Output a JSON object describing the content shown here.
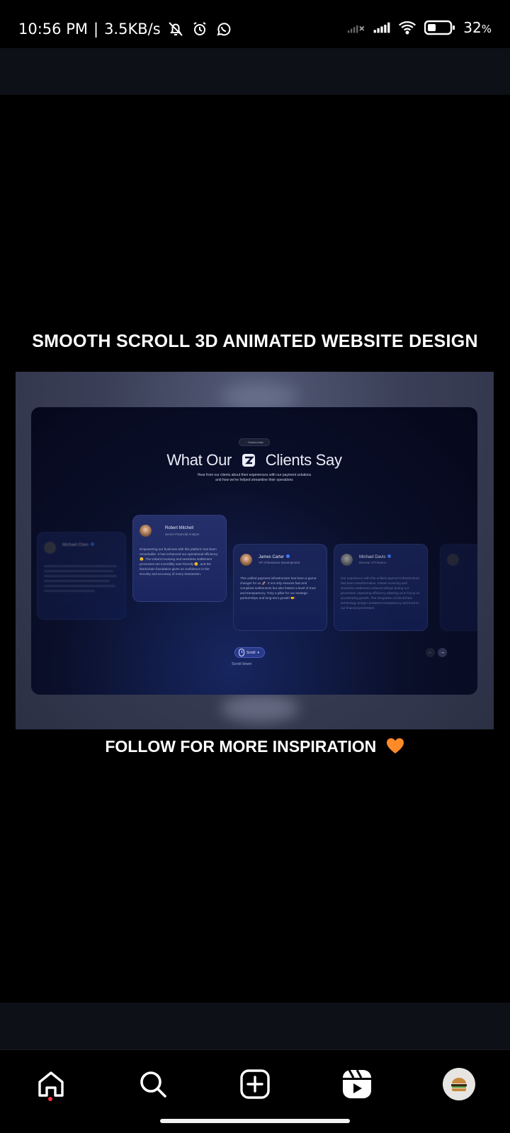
{
  "status_bar": {
    "time": "10:56 PM",
    "separator": "|",
    "speed": "3.5KB/s",
    "battery": "32",
    "battery_unit": "%",
    "icons": [
      "bell-off-icon",
      "alarm-icon",
      "whatsapp-icon",
      "signal-no-service-icon",
      "signal-icon",
      "wifi-icon",
      "battery-icon"
    ]
  },
  "post": {
    "caption_top": "SMOOTH SCROLL 3D ANIMATED WEBSITE DESIGN",
    "caption_bottom": "FOLLOW FOR MORE INSPIRATION"
  },
  "website": {
    "badge": "Testimonials",
    "title_left": "What Our",
    "title_right": "Clients Say",
    "subtitle": "Hear from our clients about their experiences with our payment solutions and how we've helped streamline their operations",
    "cards": [
      {
        "name": "Michael Chen",
        "role": "",
        "body": ""
      },
      {
        "name": "Robert Mitchell",
        "role": "Senior Financial Analyst",
        "body": "Empowering our business with this platform has been remarkable. It has enhanced our operational efficiency 🙂. The instant invoicing and seamless settlement processes are incredibly user-friendly 😊, and the blockchain foundation gives us confidence in the security and accuracy of every transaction."
      },
      {
        "name": "James Carter",
        "role": "VP of Business Development",
        "body": "This unified payment infrastructure has been a game-changer for us 🚀. It not only ensures fast and compliant settlements but also fosters a level of trust and transparency. Truly a pillar for our strategic partnerships and long-term growth 🤝."
      },
      {
        "name": "Michael Davis",
        "role": "Director of Finance",
        "body": "Our experience with this unified payment infrastructure has been transformative. Instant invoicing and seamless settlement reduced delays during our processes, improving efficiency allowing us to focus on accelerating growth. The integration of blockchain technology brings consistent transparency and trust to our financial processes."
      },
      {
        "name": "",
        "role": "",
        "body": ""
      }
    ],
    "scroll_pill": "Scroll",
    "scroll_label": "Scroll down",
    "prev_arrow": "←",
    "next_arrow": "→"
  },
  "bottom_nav": {
    "items": [
      "home-icon",
      "search-icon",
      "create-icon",
      "reels-icon",
      "profile-avatar"
    ]
  },
  "colors": {
    "accent": "#3d7bff",
    "notification_dot": "#ff3040",
    "heart": "#ff8a2a"
  }
}
